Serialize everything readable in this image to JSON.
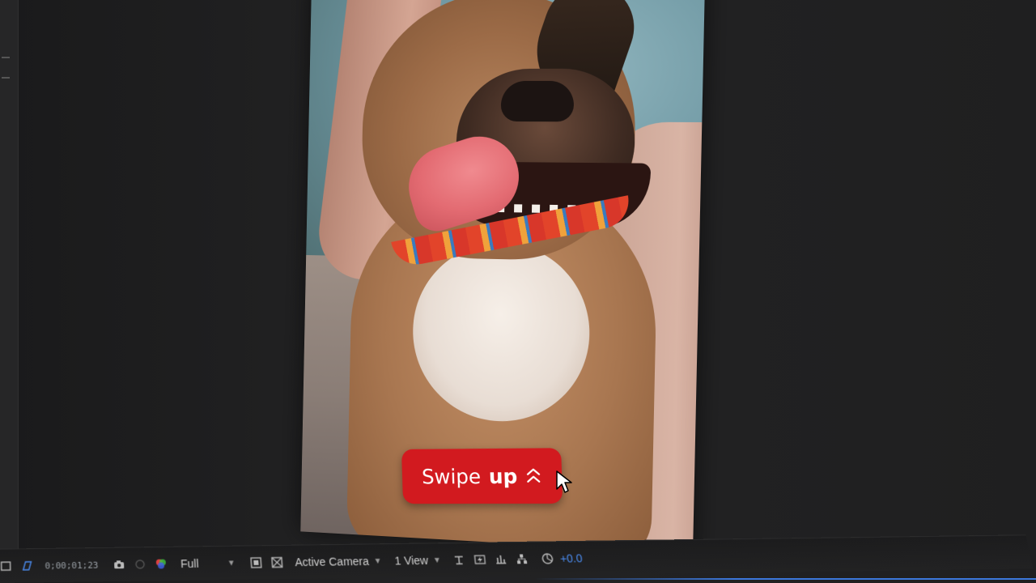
{
  "viewer": {
    "swipe_button": {
      "label_regular": "Swipe",
      "label_bold": "up",
      "color": "#d21a1f"
    }
  },
  "toolbar": {
    "timecode": "0;00;01;23",
    "resolution": "Full",
    "camera": "Active Camera",
    "views": "1 View",
    "exposure": "+0.0",
    "icons": [
      "region-of-interest-icon",
      "snapshot-icon",
      "color-channel-icon",
      "grid-icon",
      "transparency-grid-icon",
      "3d-view-icon",
      "fast-preview-icon",
      "timeline-icon",
      "flowchart-icon",
      "reset-exposure-icon"
    ],
    "accent": "#4b8cf0"
  }
}
